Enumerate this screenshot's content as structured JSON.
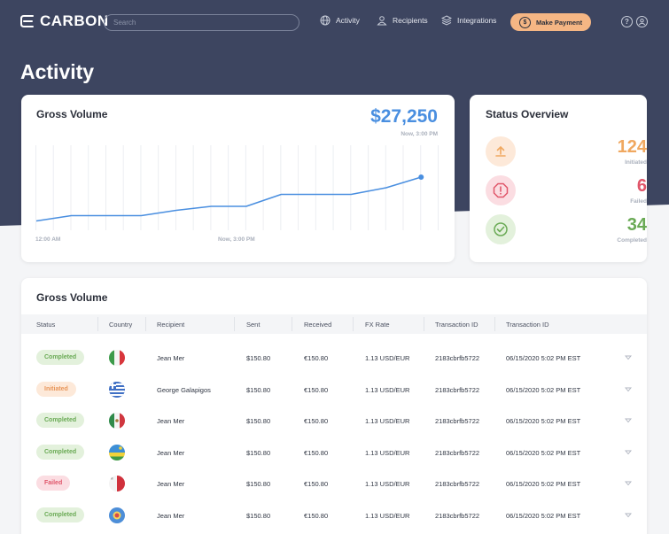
{
  "brand": {
    "name": "CARBON"
  },
  "search": {
    "placeholder": "Search"
  },
  "nav": {
    "items": [
      {
        "label": "Activity",
        "icon": "globe-icon"
      },
      {
        "label": "Recipients",
        "icon": "users-icon"
      },
      {
        "label": "Integrations",
        "icon": "layers-icon"
      }
    ],
    "make_payment": "Make Payment",
    "help_icon": "question-icon",
    "profile_icon": "user-icon"
  },
  "page": {
    "title": "Activity"
  },
  "gross_card": {
    "title": "Gross Volume",
    "amount": "$27,250",
    "time": "Now, 3:00 PM",
    "x_start": "12:00 AM",
    "x_end": "Now, 3:00 PM"
  },
  "chart_data": {
    "type": "line",
    "series": [
      {
        "values": [
          5,
          9,
          9,
          9,
          13,
          16,
          16,
          25,
          25,
          25,
          30,
          38
        ]
      }
    ],
    "grid": true,
    "ylim": [
      0,
      60
    ],
    "x_start_label": "12:00 AM",
    "x_end_label": "Now, 3:00 PM"
  },
  "status_card": {
    "title": "Status Overview",
    "items": [
      {
        "count": "124",
        "label": "Initiated",
        "color": "#f0a860",
        "icon": "upload-icon"
      },
      {
        "count": "6",
        "label": "Failed",
        "color": "#e0566a",
        "icon": "alert-icon"
      },
      {
        "count": "34",
        "label": "Completed",
        "color": "#6aaa55",
        "icon": "check-icon"
      }
    ]
  },
  "table": {
    "title": "Gross Volume",
    "columns": [
      "Status",
      "Country",
      "Recipient",
      "Sent",
      "Received",
      "FX Rate",
      "Transaction ID",
      "Transaction ID"
    ],
    "rows": [
      {
        "status": "Completed",
        "flag": "italy",
        "recipient": "Jean Mer",
        "sent": "$150.80",
        "received": "€150.80",
        "fx": "1.13 USD/EUR",
        "txid": "2183cbrfb5722",
        "date": "06/15/2020 5:02 PM EST"
      },
      {
        "status": "Initiated",
        "flag": "greece",
        "recipient": "George Galapigos",
        "sent": "$150.80",
        "received": "€150.80",
        "fx": "1.13 USD/EUR",
        "txid": "2183cbrfb5722",
        "date": "06/15/2020 5:02 PM EST"
      },
      {
        "status": "Completed",
        "flag": "mexico",
        "recipient": "Jean Mer",
        "sent": "$150.80",
        "received": "€150.80",
        "fx": "1.13 USD/EUR",
        "txid": "2183cbrfb5722",
        "date": "06/15/2020 5:02 PM EST"
      },
      {
        "status": "Completed",
        "flag": "rwanda",
        "recipient": "Jean Mer",
        "sent": "$150.80",
        "received": "€150.80",
        "fx": "1.13 USD/EUR",
        "txid": "2183cbrfb5722",
        "date": "06/15/2020 5:02 PM EST"
      },
      {
        "status": "Failed",
        "flag": "malta",
        "recipient": "Jean Mer",
        "sent": "$150.80",
        "received": "€150.80",
        "fx": "1.13 USD/EUR",
        "txid": "2183cbrfb5722",
        "date": "06/15/2020 5:02 PM EST"
      },
      {
        "status": "Completed",
        "flag": "unknown",
        "recipient": "Jean Mer",
        "sent": "$150.80",
        "received": "€150.80",
        "fx": "1.13 USD/EUR",
        "txid": "2183cbrfb5722",
        "date": "06/15/2020 5:02 PM EST"
      }
    ]
  },
  "colors": {
    "header_bg": "#3d4560",
    "accent_blue": "#4a8fe0",
    "accent_orange": "#f5b684",
    "completed_bg": "#e3f1dc",
    "completed_fg": "#6aaa55",
    "initiated_bg": "#fde9d9",
    "initiated_fg": "#e8965a",
    "failed_bg": "#fbdde2",
    "failed_fg": "#e0566a"
  }
}
